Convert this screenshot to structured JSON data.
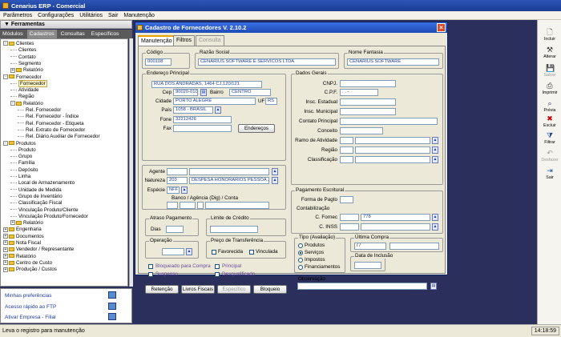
{
  "app": {
    "title": "Cenarius ERP - Comercial"
  },
  "menu": [
    "Parâmetros",
    "Configurações",
    "Utilitários",
    "Sair",
    "Manutenção"
  ],
  "left_panel": {
    "header": "Ferramentas",
    "tabs": [
      "Módulos",
      "Cadastros",
      "Consultas",
      "Específicos"
    ],
    "tree": [
      {
        "label": "Clientes",
        "level": 0,
        "folder": true,
        "toggle": "-"
      },
      {
        "label": "Clientes",
        "level": 1
      },
      {
        "label": "Contato",
        "level": 1
      },
      {
        "label": "Segmento",
        "level": 1
      },
      {
        "label": "Relatório",
        "level": 1,
        "folder": true,
        "toggle": "+"
      },
      {
        "label": "Fornecedor",
        "level": 0,
        "folder": true,
        "toggle": "-"
      },
      {
        "label": "Fornecedor",
        "level": 1,
        "selected": true
      },
      {
        "label": "Atividade",
        "level": 1
      },
      {
        "label": "Região",
        "level": 1
      },
      {
        "label": "Relatório",
        "level": 1,
        "folder": true,
        "toggle": "-"
      },
      {
        "label": "Rel. Fornecedor",
        "level": 2
      },
      {
        "label": "Rel. Fornecedor - Índice",
        "level": 2
      },
      {
        "label": "Rel. Fornecedor - Etiqueta",
        "level": 2
      },
      {
        "label": "Rel. Extrato de Fornecedor",
        "level": 2
      },
      {
        "label": "Rel. Diário Auxiliar de Fornecedor",
        "level": 2
      },
      {
        "label": "Produtos",
        "level": 0,
        "folder": true,
        "toggle": "-"
      },
      {
        "label": "Produto",
        "level": 1
      },
      {
        "label": "Grupo",
        "level": 1
      },
      {
        "label": "Família",
        "level": 1
      },
      {
        "label": "Depósito",
        "level": 1
      },
      {
        "label": "Linha",
        "level": 1
      },
      {
        "label": "Local de Armazenamento",
        "level": 1
      },
      {
        "label": "Unidade de Medida",
        "level": 1
      },
      {
        "label": "Grupo de Inventário",
        "level": 1
      },
      {
        "label": "Classificação Fiscal",
        "level": 1
      },
      {
        "label": "Vinculação Produto/Cliente",
        "level": 1
      },
      {
        "label": "Vinculação Produto/Fornecedor",
        "level": 1
      },
      {
        "label": "Relatório",
        "level": 1,
        "folder": true,
        "toggle": "+"
      },
      {
        "label": "Engenharia",
        "level": 0,
        "folder": true,
        "toggle": "+"
      },
      {
        "label": "Documentos",
        "level": 0,
        "folder": true,
        "toggle": "+"
      },
      {
        "label": "Nota Fiscal",
        "level": 0,
        "folder": true,
        "toggle": "+"
      },
      {
        "label": "Vendedor / Representante",
        "level": 0,
        "folder": true,
        "toggle": "+"
      },
      {
        "label": "Relatório",
        "level": 0,
        "folder": true,
        "toggle": "+"
      },
      {
        "label": "Centro de Custo",
        "level": 0,
        "folder": true,
        "toggle": "+"
      },
      {
        "label": "Produção / Custos",
        "level": 0,
        "folder": true,
        "toggle": "+"
      }
    ],
    "quick_links": [
      "Minhas preferências",
      "Acesso rápido ao FTP",
      "Ativar Empresa - Filial"
    ]
  },
  "status": {
    "message": "Leva o registro para manutenção",
    "clock": "14:18:59"
  },
  "toolbar": [
    {
      "label": "Incluir",
      "icon": "document-new-icon",
      "enabled": true
    },
    {
      "label": "Alterar",
      "icon": "tools-icon",
      "enabled": true
    },
    {
      "label": "Salvar",
      "icon": "disk-icon",
      "enabled": false
    },
    {
      "label": "Imprimir",
      "icon": "printer-icon",
      "enabled": true
    },
    {
      "label": "Prévia",
      "icon": "preview-icon",
      "enabled": true
    },
    {
      "label": "Excluir",
      "icon": "delete-x-icon",
      "enabled": true
    },
    {
      "label": "Filtrar",
      "icon": "funnel-icon",
      "enabled": true
    },
    {
      "label": "Desfazer",
      "icon": "undo-icon",
      "enabled": false
    },
    {
      "label": "Sair",
      "icon": "exit-icon",
      "enabled": true
    }
  ],
  "dialog": {
    "title": "Cadastro de Fornecedores  V. 2.10.2",
    "tabs": [
      {
        "label": "Manutenção",
        "active": true,
        "enabled": true
      },
      {
        "label": "Filtros",
        "active": false,
        "enabled": true
      },
      {
        "label": "Consulta",
        "active": false,
        "enabled": false
      }
    ],
    "codigo": {
      "label": "Código",
      "value": "000108"
    },
    "razao": {
      "label": "Razão Social",
      "value": "CENARIUS SOFTWARE E SERVICOS LTDA"
    },
    "fantasia": {
      "label": "Nome Fantasia",
      "value": "CENARIUS SOFTWARE"
    },
    "endereco": {
      "title": "Endereço Principal",
      "logradouro": "RUA DOS ANDRADAS, 1464 CJ.120/121",
      "cep_label": "Cep",
      "cep": "90020-010",
      "bairro_label": "Bairro",
      "bairro": "CENTRO",
      "cidade_label": "Cidade",
      "cidade": "PORTO ALEGRE",
      "uf_label": "UF",
      "uf": "RS",
      "pais_label": "País",
      "pais": "1058 - BRASIL",
      "fone_label": "Fone",
      "fone": "32212426",
      "fax_label": "Fax",
      "btn_enderecos": "Endereços"
    },
    "dados_gerais": {
      "title": "Dados Gerais",
      "cnpj_label": "CNPJ.",
      "cpf_label": "C.P.F.",
      "cpf_mask": ". . -",
      "insc_est_label": "Insc. Estadual",
      "insc_mun_label": "Insc. Municipal",
      "contato_label": "Contato Principal",
      "conceito_label": "Conceito",
      "ramo_label": "Ramo de Atividade",
      "regiao_label": "Região",
      "classificacao_label": "Classificação"
    },
    "agente_label": "Agente",
    "natureza_label": "Natureza",
    "natureza_code": "203",
    "natureza_desc": "DESPESA HONORARIOS PESSOA J",
    "especie_label": "Espécie",
    "especie": "NFF",
    "banco_label": "Banco / Agência (Dig) / Conta",
    "pagamento": {
      "title": "Pagamento Escritural",
      "forma_label": "Forma de Pagto",
      "contab_title": "Contabilização",
      "fornec_label": "C. Fornec",
      "fornec_value": "778",
      "inss_label": "C. INSS"
    },
    "atraso": {
      "title": "Atraso Pagamento",
      "dias_label": "Dias"
    },
    "limite": {
      "title": "Limite de Crédito"
    },
    "operacao": {
      "title": "Operação"
    },
    "preco_transf": {
      "title": "Preço de Transferência",
      "opt1": "Favorecida",
      "opt2": "Vinculada"
    },
    "flags": [
      "Bloqueado para Compra",
      "Suspenso",
      "Principal",
      "Desqualificado"
    ],
    "tipo": {
      "title": "Tipo (Avaliação)",
      "options": [
        "Produtos",
        "Serviços",
        "Impostos",
        "Financiamentos"
      ],
      "selected": "Serviços"
    },
    "ultima_compra": {
      "title": "Última Compra",
      "value": "/ /"
    },
    "data_inclusao": {
      "title": "Data de Inclusão"
    },
    "observacao": {
      "title": "Observação"
    },
    "buttons": [
      {
        "label": "Retenção",
        "enabled": true
      },
      {
        "label": "Livros Fiscais",
        "enabled": true
      },
      {
        "label": "Específico",
        "enabled": false
      },
      {
        "label": "Bloqueio",
        "enabled": true
      }
    ]
  }
}
